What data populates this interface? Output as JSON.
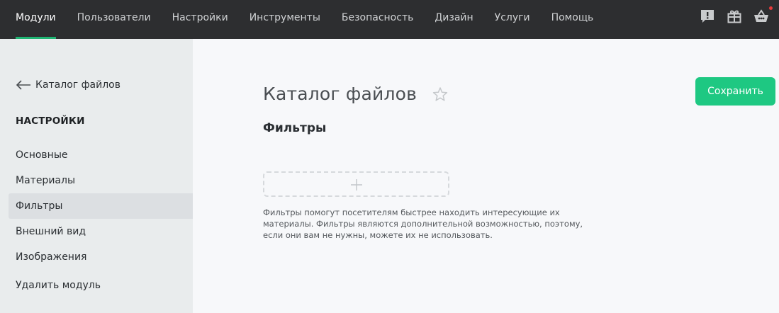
{
  "nav": {
    "items": [
      {
        "label": "Модули",
        "active": true
      },
      {
        "label": "Пользователи"
      },
      {
        "label": "Настройки"
      },
      {
        "label": "Инструменты"
      },
      {
        "label": "Безопасность"
      },
      {
        "label": "Дизайн"
      },
      {
        "label": "Услуги"
      },
      {
        "label": "Помощь"
      }
    ],
    "icons": [
      "alert-message-icon",
      "gift-icon",
      "cart-icon"
    ],
    "accent_color": "#1fb573",
    "notification_color": "#e63b3b"
  },
  "sidebar": {
    "back_label": "Каталог файлов",
    "heading": "НАСТРОЙКИ",
    "items": [
      {
        "label": "Основные"
      },
      {
        "label": "Материалы"
      },
      {
        "label": "Фильтры",
        "active": true
      },
      {
        "label": "Внешний вид"
      },
      {
        "label": "Изображения"
      }
    ],
    "delete_label": "Удалить модуль"
  },
  "main": {
    "title": "Каталог файлов",
    "section_title": "Фильтры",
    "hint": "Фильтры помогут посетителям быстрее находить интересующие их материалы. Фильтры являются дополнительной возможностью, поэтому, если они вам не нужны, можете их не использовать.",
    "save_label": "Сохранить",
    "save_color": "#1ec882"
  }
}
